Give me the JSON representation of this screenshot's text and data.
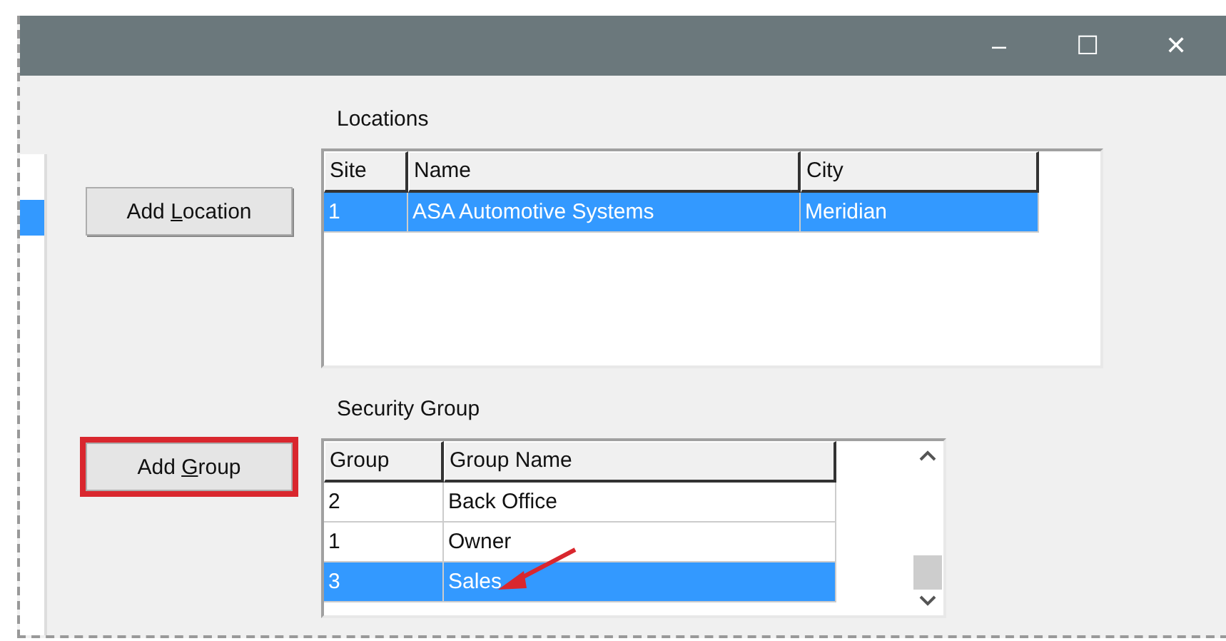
{
  "window": {
    "controls": [
      "–",
      "☐",
      "✕"
    ]
  },
  "locations": {
    "label": "Locations",
    "button": {
      "label": "Add ",
      "accel": "L",
      "rest": "ocation",
      "highlighted": false
    },
    "columns": [
      "Site",
      "Name",
      "City"
    ],
    "rows": [
      {
        "cells": [
          "1",
          "ASA Automotive Systems",
          "Meridian"
        ],
        "selected": true
      }
    ]
  },
  "security_group": {
    "label": "Security Group",
    "button": {
      "label": "Add ",
      "accel": "G",
      "rest": "roup",
      "highlighted": true
    },
    "columns": [
      "Group",
      "Group Name"
    ],
    "rows": [
      {
        "cells": [
          "2",
          "Back Office"
        ],
        "selected": false
      },
      {
        "cells": [
          "1",
          "Owner"
        ],
        "selected": false
      },
      {
        "cells": [
          "3",
          "Sales"
        ],
        "selected": true
      }
    ]
  }
}
